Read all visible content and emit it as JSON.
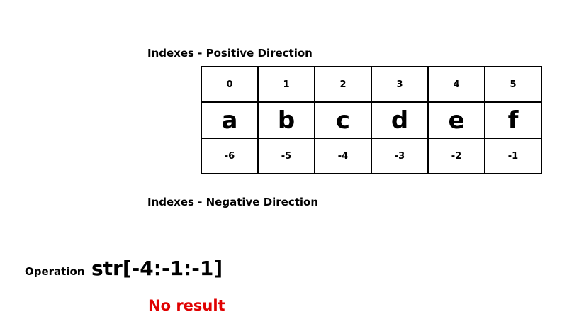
{
  "labels": {
    "positive": "Indexes - Positive Direction",
    "negative": "Indexes - Negative Direction"
  },
  "table": {
    "positive_indexes": [
      "0",
      "1",
      "2",
      "3",
      "4",
      "5"
    ],
    "characters": [
      "a",
      "b",
      "c",
      "d",
      "e",
      "f"
    ],
    "negative_indexes": [
      "-6",
      "-5",
      "-4",
      "-3",
      "-2",
      "-1"
    ]
  },
  "operation": {
    "label": "Operation",
    "code": "str[-4:-1:-1]"
  },
  "result": {
    "text": "No result",
    "color": "#e00000"
  }
}
